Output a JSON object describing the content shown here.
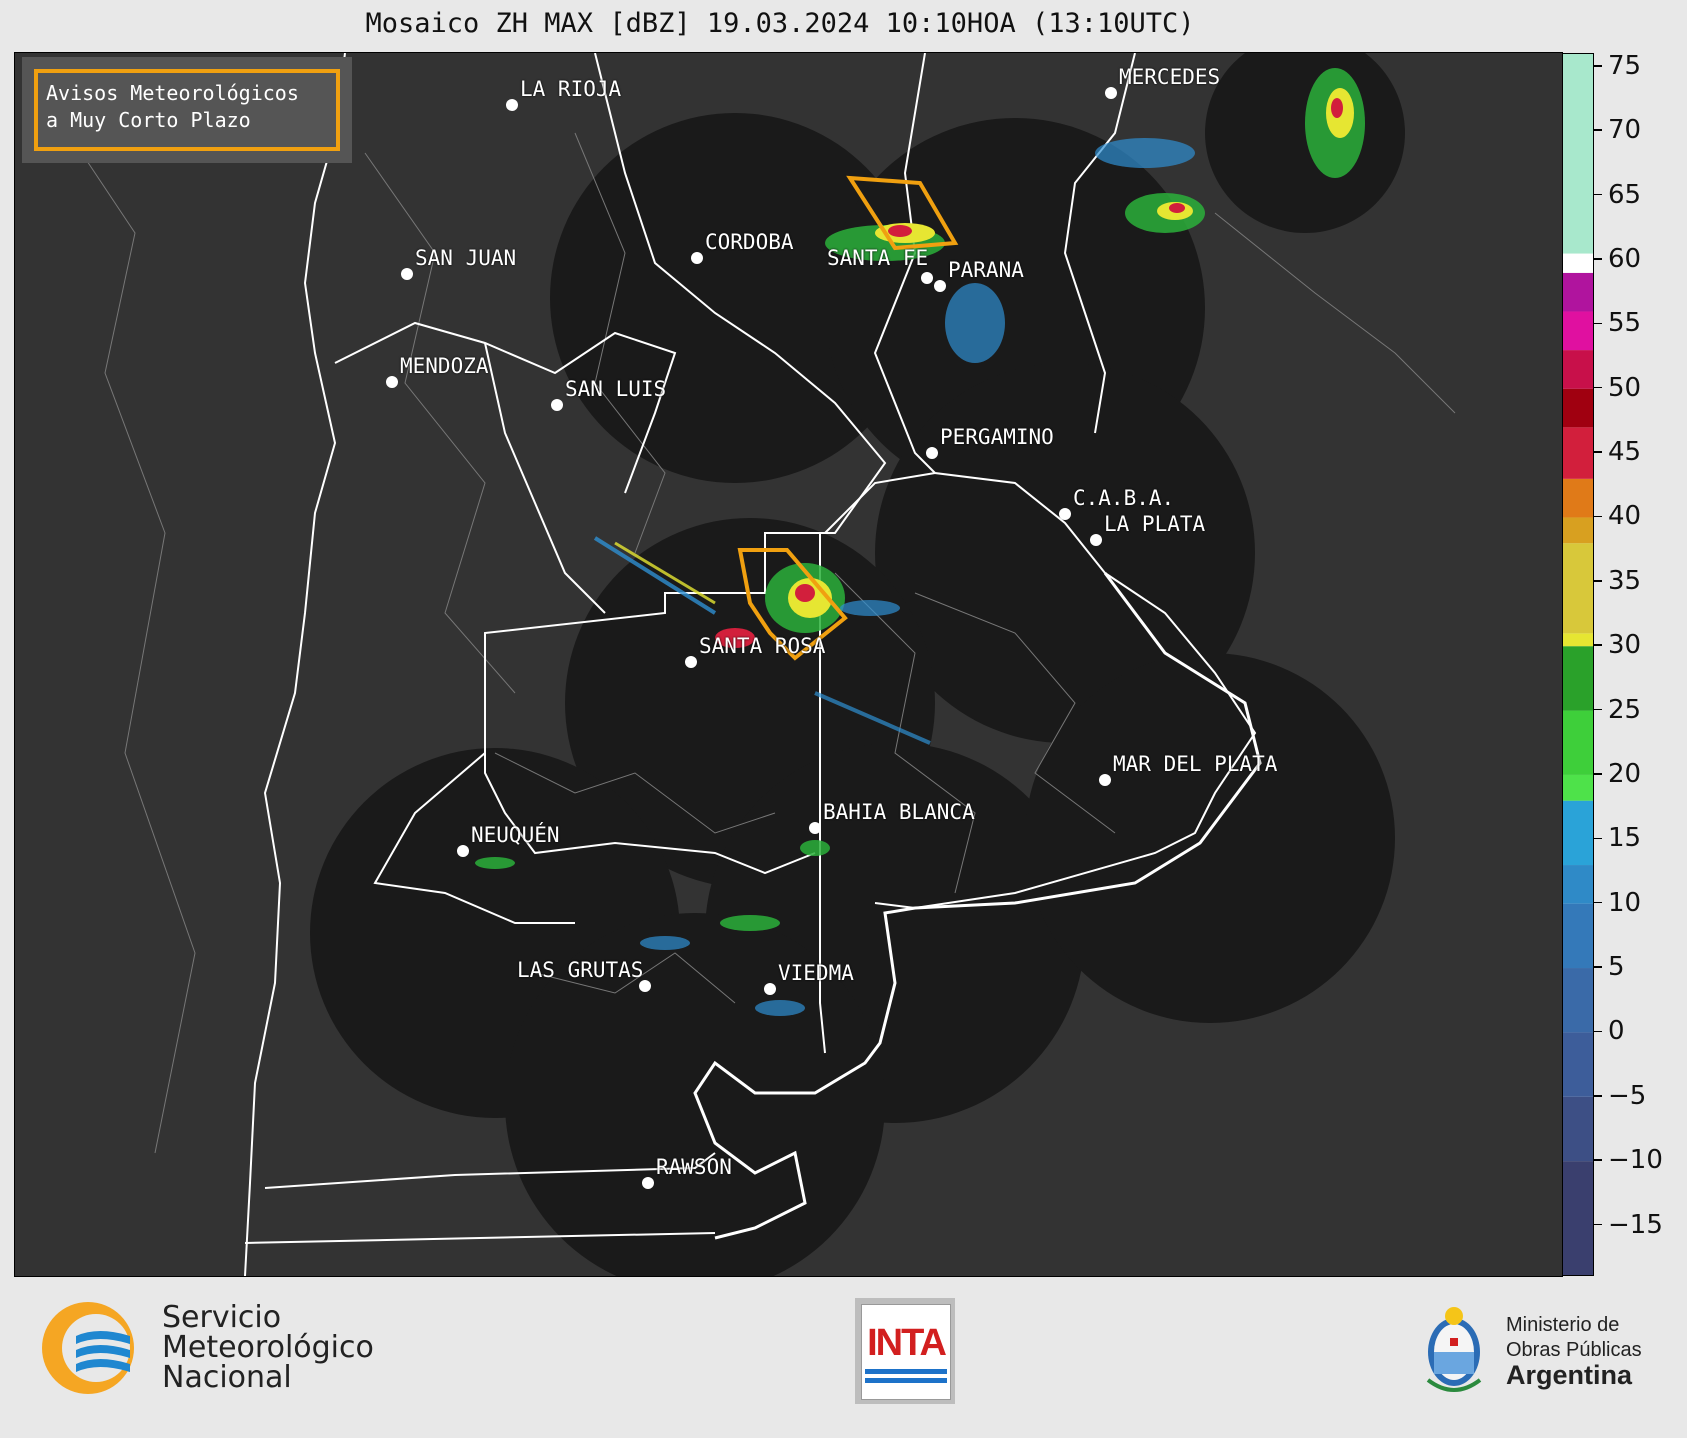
{
  "title": "Mosaico ZH MAX [dBZ] 19.03.2024 10:10HOA (13:10UTC)",
  "alert_legend": {
    "line1": "Avisos Meteorológicos",
    "line2": "a Muy Corto Plazo",
    "color": "#f0a010"
  },
  "cities": [
    {
      "name": "LA RIOJA"
    },
    {
      "name": "MERCEDES"
    },
    {
      "name": "SAN JUAN"
    },
    {
      "name": "CORDOBA"
    },
    {
      "name": "SANTA FE"
    },
    {
      "name": "PARANA"
    },
    {
      "name": "MENDOZA"
    },
    {
      "name": "SAN LUIS"
    },
    {
      "name": "PERGAMINO"
    },
    {
      "name": "C.A.B.A."
    },
    {
      "name": "LA PLATA"
    },
    {
      "name": "SANTA ROSA"
    },
    {
      "name": "MAR DEL PLATA"
    },
    {
      "name": "BAHIA BLANCA"
    },
    {
      "name": "NEUQUÉN"
    },
    {
      "name": "LAS GRUTAS"
    },
    {
      "name": "VIEDMA"
    },
    {
      "name": "RAWSON"
    }
  ],
  "colorbar": {
    "unit": "dBZ",
    "min": -19,
    "max": 76,
    "ticks": [
      "75",
      "70",
      "65",
      "60",
      "55",
      "50",
      "45",
      "40",
      "35",
      "30",
      "25",
      "20",
      "15",
      "10",
      "5",
      "0",
      "−5",
      "−10",
      "−15"
    ],
    "tick_values": [
      75,
      70,
      65,
      60,
      55,
      50,
      45,
      40,
      35,
      30,
      25,
      20,
      15,
      10,
      5,
      0,
      -5,
      -10,
      -15
    ]
  },
  "footer": {
    "smn_line1": "Servicio",
    "smn_line2": "Meteorológico",
    "smn_line3": "Nacional",
    "inta": "INTA",
    "mop_line1": "Ministerio de",
    "mop_line2": "Obras Públicas",
    "mop_line3": "Argentina"
  },
  "colors": {
    "map_background": "#333333",
    "radar_coverage": "#1a1a1a",
    "boundary": "#ffffff",
    "department_line": "#777777",
    "alert_polygon": "#f0a010"
  }
}
